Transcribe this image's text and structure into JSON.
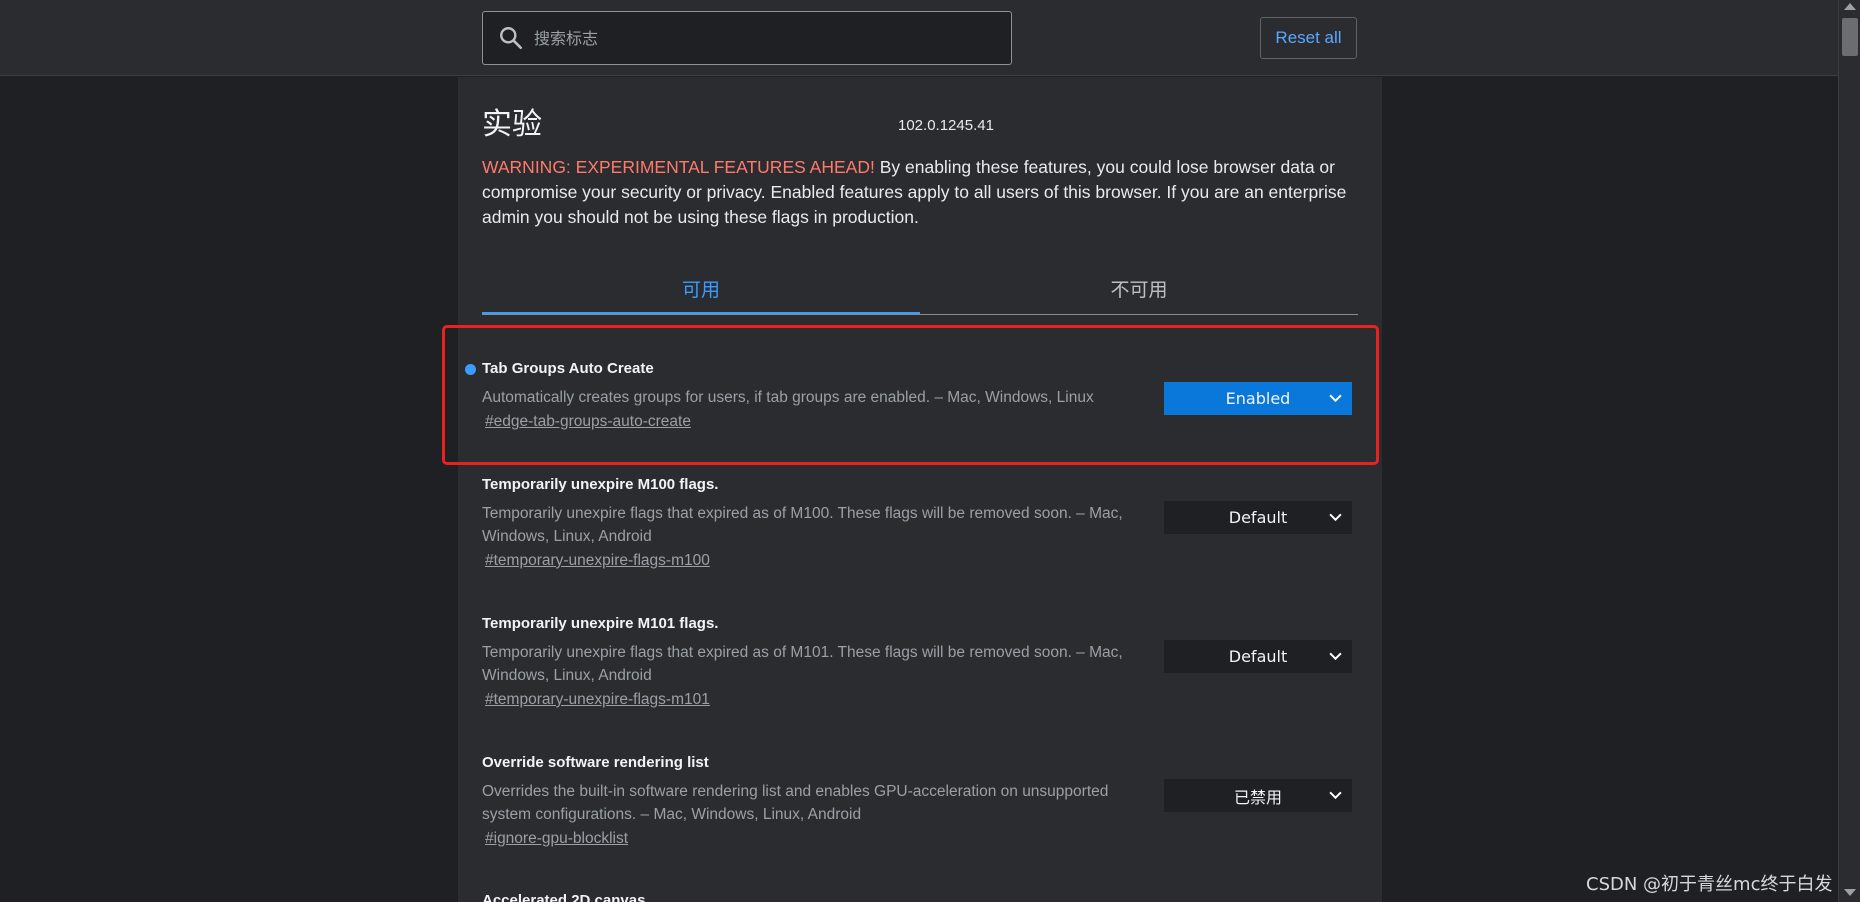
{
  "search": {
    "placeholder": "搜索标志"
  },
  "toolbar": {
    "reset_label": "Reset all"
  },
  "page": {
    "title": "实验",
    "version": "102.0.1245.41",
    "warning_label": "WARNING: EXPERIMENTAL FEATURES AHEAD!",
    "warning_text": " By enabling these features, you could lose browser data or compromise your security or privacy. Enabled features apply to all users of this browser. If you are an enterprise admin you should not be using these flags in production."
  },
  "tabs": [
    {
      "label": "可用",
      "active": true
    },
    {
      "label": "不可用",
      "active": false
    }
  ],
  "experiments": [
    {
      "title": "Tab Groups Auto Create",
      "description": "Automatically creates groups for users, if tab groups are enabled. – Mac, Windows, Linux",
      "link": "#edge-tab-groups-auto-create",
      "value": "Enabled",
      "modified": true
    },
    {
      "title": "Temporarily unexpire M100 flags.",
      "description": "Temporarily unexpire flags that expired as of M100. These flags will be removed soon. – Mac, Windows, Linux, Android",
      "link": "#temporary-unexpire-flags-m100",
      "value": "Default",
      "modified": false
    },
    {
      "title": "Temporarily unexpire M101 flags.",
      "description": "Temporarily unexpire flags that expired as of M101. These flags will be removed soon. – Mac, Windows, Linux, Android",
      "link": "#temporary-unexpire-flags-m101",
      "value": "Default",
      "modified": false
    },
    {
      "title": "Override software rendering list",
      "description": "Overrides the built-in software rendering list and enables GPU-acceleration on unsupported system configurations. – Mac, Windows, Linux, Android",
      "link": "#ignore-gpu-blocklist",
      "value": "已禁用",
      "modified": false
    },
    {
      "title": "Accelerated 2D canvas",
      "description": "",
      "link": "",
      "value": "",
      "modified": false
    }
  ],
  "watermark": "CSDN @初于青丝mc终于白发",
  "colors": {
    "accent": "#3b9cff",
    "warning": "#ff7a6b",
    "enabled_select": "#0a78db",
    "highlight_box": "#e8231f"
  }
}
